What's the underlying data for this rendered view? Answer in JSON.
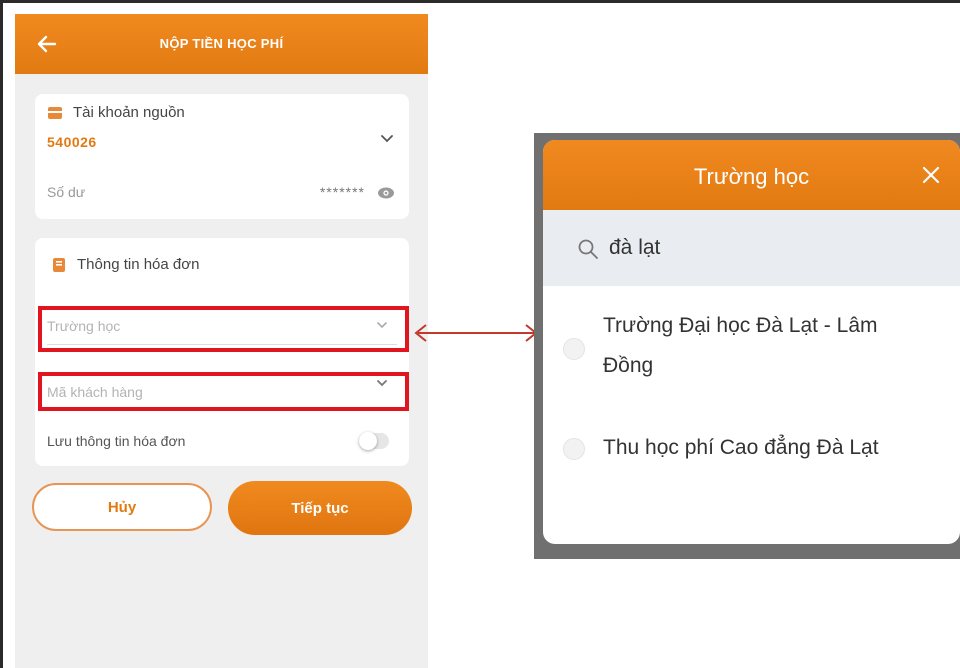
{
  "phone": {
    "header": {
      "title": "NỘP TIỀN HỌC PHÍ"
    },
    "source_account": {
      "heading": "Tài khoản nguồn",
      "account_number": "540026",
      "balance_label": "Số dư",
      "balance_masked": "*******"
    },
    "invoice": {
      "heading": "Thông tin hóa đơn",
      "school_placeholder": "Trường học",
      "customer_code_placeholder": "Mã khách hàng",
      "save_label": "Lưu thông tin hóa đơn",
      "save_toggle_on": false
    },
    "buttons": {
      "cancel": "Hủy",
      "continue": "Tiếp tục"
    }
  },
  "popup": {
    "title": "Trường học",
    "search_value": "đà lạt",
    "results": [
      {
        "label": "Trường Đại học Đà Lạt - Lâm Đồng",
        "line1": "Trường Đại học Đà Lạt - Lâm",
        "line2": "Đồng"
      },
      {
        "label": "Thu học phí Cao đẳng Đà Lạt"
      }
    ]
  },
  "colors": {
    "brand_orange": "#e27a12",
    "highlight_red": "#e1151f",
    "connector_red": "#c0392b"
  },
  "icons": [
    "back-arrow-icon",
    "wallet-icon",
    "chevron-down-icon",
    "eye-icon",
    "invoice-icon",
    "close-icon",
    "search-icon",
    "double-arrow-icon"
  ]
}
